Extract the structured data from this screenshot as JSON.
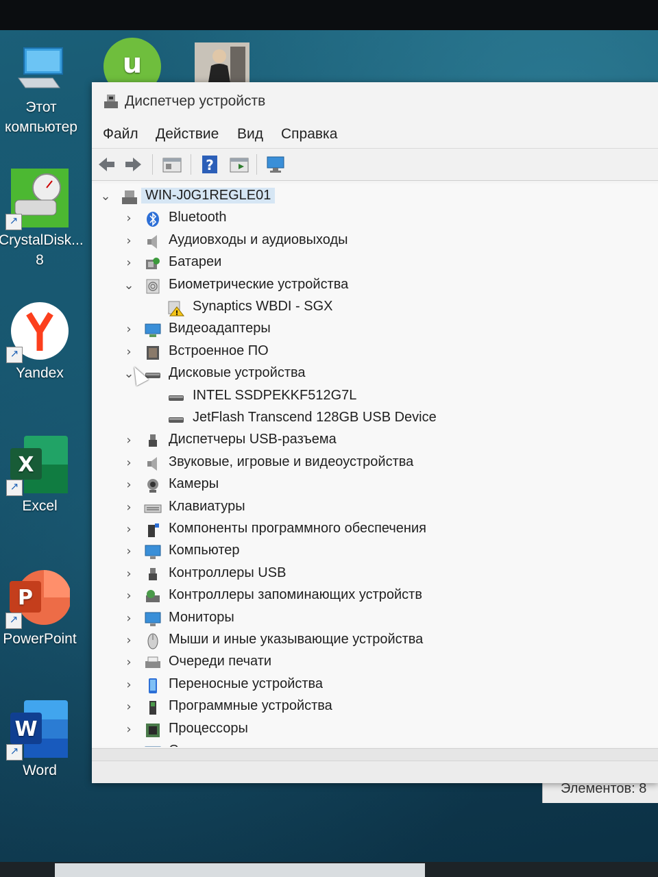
{
  "desktop_icons": [
    {
      "name": "this-pc",
      "label_lines": [
        "Этот",
        "компьютер"
      ]
    },
    {
      "name": "crystaldisk",
      "label_lines": [
        "CrystalDisk...",
        "8"
      ]
    },
    {
      "name": "yandex",
      "label_lines": [
        "Yandex"
      ]
    },
    {
      "name": "excel",
      "label_lines": [
        "Excel"
      ]
    },
    {
      "name": "powerpoint",
      "label_lines": [
        "PowerPoint"
      ]
    },
    {
      "name": "word",
      "label_lines": [
        "Word"
      ]
    }
  ],
  "window": {
    "title": "Диспетчер устройств",
    "menu": [
      "Файл",
      "Действие",
      "Вид",
      "Справка"
    ],
    "toolbar": [
      "back",
      "forward",
      "properties",
      "help",
      "update-driver",
      "scan-hardware"
    ],
    "tree": {
      "root": "WIN-J0G1REGLE01",
      "items": [
        {
          "label": "Bluetooth",
          "expanded": false,
          "icon": "bluetooth-icon"
        },
        {
          "label": "Аудиовходы и аудиовыходы",
          "expanded": false,
          "icon": "speaker-icon"
        },
        {
          "label": "Батареи",
          "expanded": false,
          "icon": "battery-icon"
        },
        {
          "label": "Биометрические устройства",
          "expanded": true,
          "icon": "fingerprint-icon",
          "children": [
            {
              "label": "Synaptics WBDI - SGX",
              "icon": "warning-device-icon"
            }
          ]
        },
        {
          "label": "Видеоадаптеры",
          "expanded": false,
          "icon": "display-adapter-icon"
        },
        {
          "label": "Встроенное ПО",
          "expanded": false,
          "icon": "firmware-icon"
        },
        {
          "label": "Дисковые устройства",
          "expanded": true,
          "icon": "disk-drive-icon",
          "children": [
            {
              "label": "INTEL SSDPEKKF512G7L",
              "icon": "disk-drive-icon"
            },
            {
              "label": "JetFlash Transcend 128GB USB Device",
              "icon": "disk-drive-icon"
            }
          ]
        },
        {
          "label": "Диспетчеры USB-разъема",
          "expanded": false,
          "icon": "usb-connector-icon"
        },
        {
          "label": "Звуковые, игровые и видеоустройства",
          "expanded": false,
          "icon": "speaker-icon"
        },
        {
          "label": "Камеры",
          "expanded": false,
          "icon": "camera-icon"
        },
        {
          "label": "Клавиатуры",
          "expanded": false,
          "icon": "keyboard-icon"
        },
        {
          "label": "Компоненты программного обеспечения",
          "expanded": false,
          "icon": "software-component-icon"
        },
        {
          "label": "Компьютер",
          "expanded": false,
          "icon": "computer-icon"
        },
        {
          "label": "Контроллеры USB",
          "expanded": false,
          "icon": "usb-icon"
        },
        {
          "label": "Контроллеры запоминающих устройств",
          "expanded": false,
          "icon": "storage-controller-icon"
        },
        {
          "label": "Мониторы",
          "expanded": false,
          "icon": "monitor-icon"
        },
        {
          "label": "Мыши и иные указывающие устройства",
          "expanded": false,
          "icon": "mouse-icon"
        },
        {
          "label": "Очереди печати",
          "expanded": false,
          "icon": "printer-icon"
        },
        {
          "label": "Переносные устройства",
          "expanded": false,
          "icon": "portable-device-icon"
        },
        {
          "label": "Программные устройства",
          "expanded": false,
          "icon": "software-device-icon"
        },
        {
          "label": "Процессоры",
          "expanded": false,
          "icon": "processor-icon"
        },
        {
          "label": "Сетевые адаптеры",
          "expanded": false,
          "icon": "network-adapter-icon"
        }
      ]
    }
  },
  "explorer_status": "Элементов: 8"
}
